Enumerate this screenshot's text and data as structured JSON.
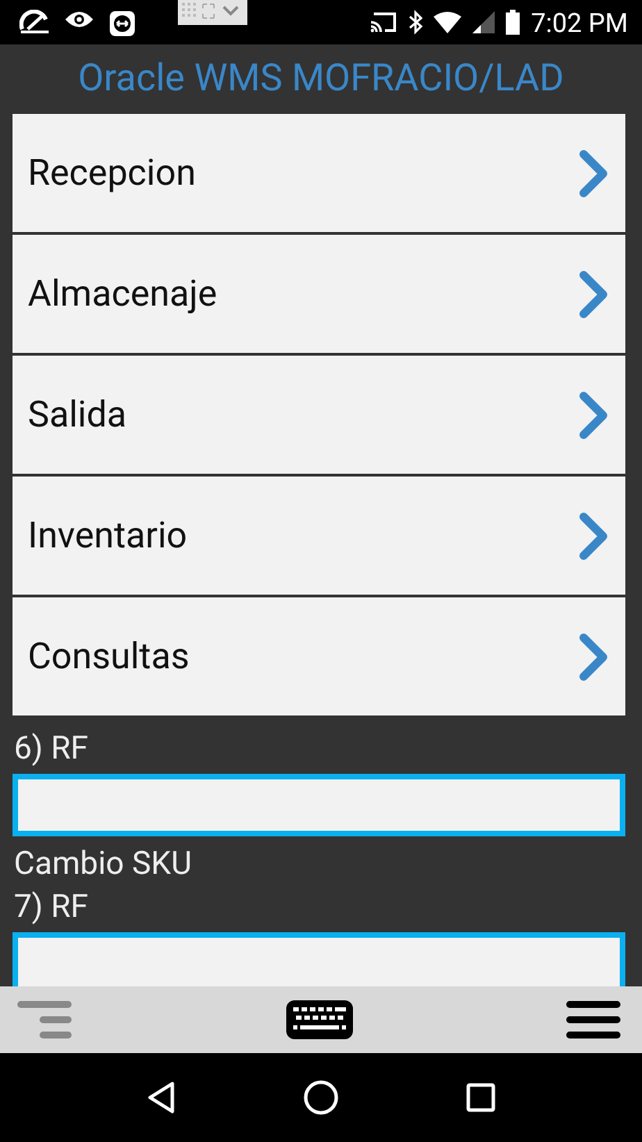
{
  "status_bar": {
    "time": "7:02 PM"
  },
  "header": {
    "title": "Oracle WMS MOFRACIO/LAD"
  },
  "menu": [
    {
      "label": "Recepcion"
    },
    {
      "label": "Almacenaje"
    },
    {
      "label": "Salida"
    },
    {
      "label": "Inventario"
    },
    {
      "label": "Consultas"
    }
  ],
  "form": [
    {
      "kind": "field",
      "label": "6) RF"
    },
    {
      "kind": "text",
      "label": "Cambio SKU"
    },
    {
      "kind": "field",
      "label": "7) RF"
    }
  ]
}
